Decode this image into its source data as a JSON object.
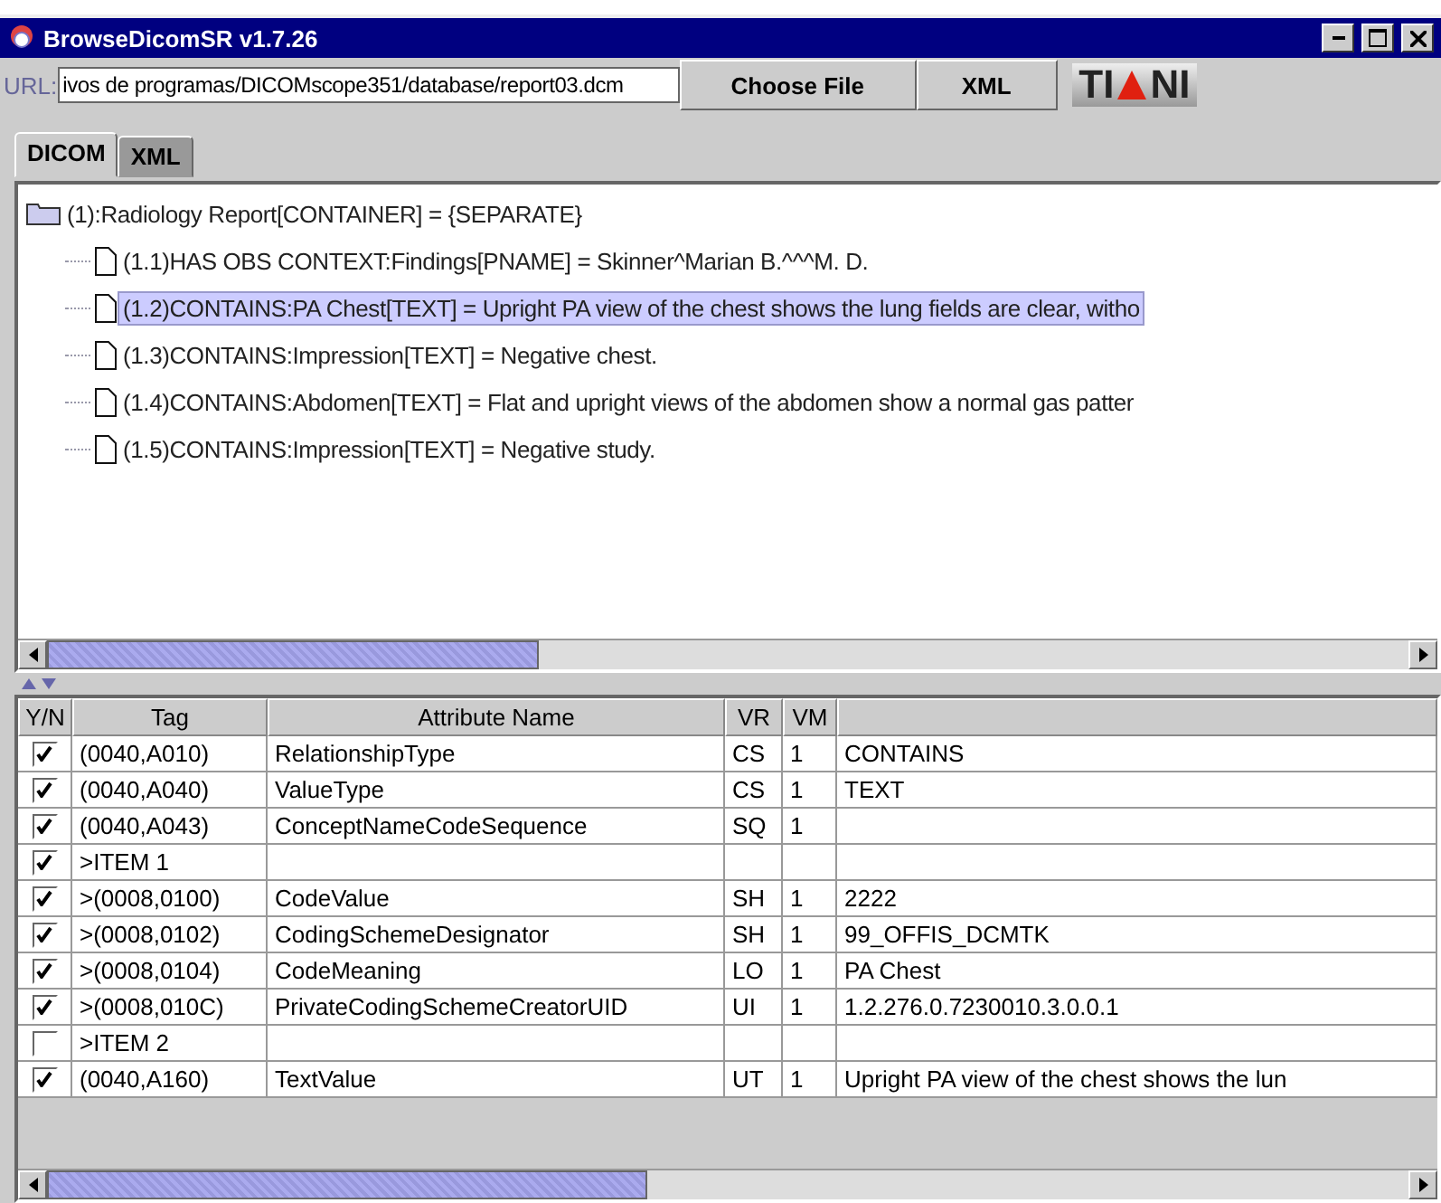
{
  "window": {
    "title": "BrowseDicomSR v1.7.26"
  },
  "toolbar": {
    "url_label": "URL:",
    "url_value": "ivos de programas/DICOMscope351/database/report03.dcm",
    "buttons": [
      "Choose File",
      "XML"
    ],
    "logo_text": [
      "TI",
      "NI"
    ]
  },
  "tabs": [
    {
      "label": "DICOM",
      "selected": true
    },
    {
      "label": "XML",
      "selected": false
    }
  ],
  "tree": {
    "label": "(1):Radiology Report[CONTAINER] = {SEPARATE}",
    "kind": "folder",
    "selected": false,
    "children": [
      {
        "label": "(1.1)HAS OBS CONTEXT:Findings[PNAME] = Skinner^Marian B.^^^M. D.",
        "kind": "document",
        "selected": false
      },
      {
        "label": "(1.2)CONTAINS:PA Chest[TEXT] = Upright PA view of the chest shows the lung fields are clear, witho",
        "kind": "document",
        "selected": true
      },
      {
        "label": "(1.3)CONTAINS:Impression[TEXT] = Negative chest.",
        "kind": "document",
        "selected": false
      },
      {
        "label": "(1.4)CONTAINS:Abdomen[TEXT] = Flat and upright views of the abdomen show a normal gas patter",
        "kind": "document",
        "selected": false
      },
      {
        "label": "(1.5)CONTAINS:Impression[TEXT] = Negative study.",
        "kind": "document",
        "selected": false
      }
    ]
  },
  "table": {
    "columns": [
      "Y/N",
      "Tag",
      "Attribute Name",
      "VR",
      "VM"
    ],
    "rows": [
      {
        "checked": true,
        "tag": "(0040,A010)",
        "name": "RelationshipType",
        "vr": "CS",
        "vm": "1",
        "value": "CONTAINS"
      },
      {
        "checked": true,
        "tag": "(0040,A040)",
        "name": "ValueType",
        "vr": "CS",
        "vm": "1",
        "value": "TEXT"
      },
      {
        "checked": true,
        "tag": "(0040,A043)",
        "name": "ConceptNameCodeSequence",
        "vr": "SQ",
        "vm": "1"
      },
      {
        "checked": true,
        "tag": ">ITEM 1"
      },
      {
        "checked": true,
        "tag": ">(0008,0100)",
        "name": "CodeValue",
        "vr": "SH",
        "vm": "1",
        "value": "2222"
      },
      {
        "checked": true,
        "tag": ">(0008,0102)",
        "name": "CodingSchemeDesignator",
        "vr": "SH",
        "vm": "1",
        "value": "99_OFFIS_DCMTK"
      },
      {
        "checked": true,
        "tag": ">(0008,0104)",
        "name": "CodeMeaning",
        "vr": "LO",
        "vm": "1",
        "value": "PA Chest"
      },
      {
        "checked": true,
        "tag": ">(0008,010C)",
        "name": "PrivateCodingSchemeCreatorUID",
        "vr": "UI",
        "vm": "1",
        "value": "1.2.276.0.7230010.3.0.0.1"
      },
      {
        "checked": false,
        "tag": ">ITEM 2"
      },
      {
        "checked": true,
        "tag": "(0040,A160)",
        "name": "TextValue",
        "vr": "UT",
        "vm": "1",
        "value": "Upright PA view of the chest shows the lun"
      }
    ]
  }
}
